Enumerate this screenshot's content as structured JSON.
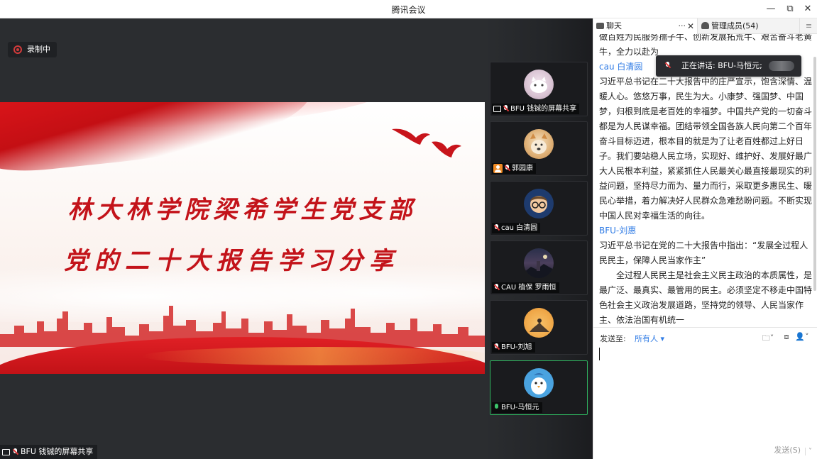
{
  "window": {
    "title": "腾讯会议",
    "minimize": "—",
    "restore": "⧉",
    "close": "✕"
  },
  "stage": {
    "recording_label": "录制中",
    "slide_line1": "林大林学院梁希学生党支部",
    "slide_line2": "党的二十大报告学习分享",
    "share_label": "BFU 钱铖的屏幕共享"
  },
  "participants": [
    {
      "name": "BFU 钱铖的屏幕共享",
      "badge": "screen",
      "mic": "muted"
    },
    {
      "name": "郭园康",
      "badge": "user",
      "mic": "muted"
    },
    {
      "name": "cau 白清圆",
      "badge": "none",
      "mic": "muted"
    },
    {
      "name": "CAU 植保 罗雨恒",
      "badge": "none",
      "mic": "muted"
    },
    {
      "name": "BFU-刘旭",
      "badge": "none",
      "mic": "muted"
    },
    {
      "name": "BFU-马恒元",
      "badge": "none",
      "mic": "on"
    }
  ],
  "panel": {
    "tab_chat": "聊天",
    "tab_more": "···",
    "tab_close": "✕",
    "tab_members": "管理成员(54)",
    "menu": "≡",
    "speaking": "正在讲话: BFU-马恒元;",
    "messages": {
      "m0a": "做百姓为民服务孺子牛、创新发展拓荒牛、艰苦奋斗老黄",
      "m0b": "牛，全力以赴为",
      "s1": "cau 白清圆",
      "m1": "习近平总书记在二十大报告中的庄严宣示，饱含深情、温暖人心。悠悠万事，民生为大。小康梦、强国梦、中国梦，归根到底是老百姓的幸福梦。中国共产党的一切奋斗都是为人民谋幸福。团结带领全国各族人民向第二个百年奋斗目标迈进，根本目的就是为了让老百姓都过上好日子。我们要站稳人民立场，实现好、维护好、发展好最广大人民根本利益，紧紧抓住人民最关心最直接最现实的利益问题，坚持尽力而为、量力而行，采取更多惠民生、暖民心举措，着力解决好人民群众急难愁盼问题。不断实现中国人民对幸福生活的向往。",
      "s2": "BFU-刘惠",
      "m2": "习近平总书记在党的二十大报告中指出：“发展全过程人民民主，保障人民当家作主”",
      "m3": "全过程人民民主是社会主义民主政治的本质属性，是最广泛、最真实、最管用的民主。必须坚定不移走中国特色社会主义政治发展道路，坚持党的领导、人民当家作主、依法治国有机统一"
    },
    "compose": {
      "sendto_label": "发送至:",
      "sendto_value": "所有人 ▾",
      "tool_folder": "🗀˅",
      "tool_shot": "⧈",
      "tool_user": "👤˅",
      "send_label": "发送(S)",
      "send_arrow": "˅"
    }
  }
}
